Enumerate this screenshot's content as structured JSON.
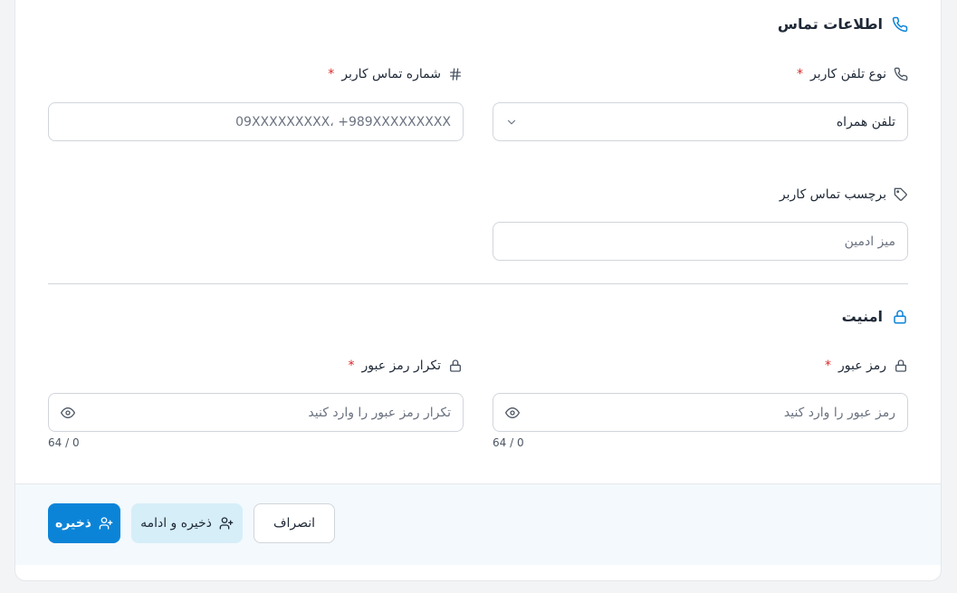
{
  "contact_section": {
    "title": "اطلاعات تماس",
    "phone_type": {
      "label": "نوع تلفن کاربر",
      "required_mark": "*",
      "value": "تلفن همراه"
    },
    "phone_number": {
      "label": "شماره تماس کاربر",
      "required_mark": "*",
      "placeholder": "09XXXXXXXXX، +989XXXXXXXXX"
    },
    "contact_tag": {
      "label": "برچسب تماس کاربر",
      "placeholder": "میز ادمین"
    }
  },
  "security_section": {
    "title": "امنیت",
    "password": {
      "label": "رمز عبور",
      "required_mark": "*",
      "placeholder": "رمز عبور را وارد کنید",
      "counter": "64 / 0"
    },
    "password_confirm": {
      "label": "تکرار رمز عبور",
      "required_mark": "*",
      "placeholder": "تکرار رمز عبور را وارد کنید",
      "counter": "64 / 0"
    }
  },
  "footer": {
    "save_label": "ذخیره",
    "save_continue_label": "ذخیره و ادامه",
    "cancel_label": "انصراف"
  },
  "colors": {
    "accent": "#0b84d8",
    "required": "#dc2626",
    "footer_bg": "#f3f9fc",
    "soft_button": "#d6eef8"
  },
  "icons": {
    "contact_title": "phone-icon",
    "phone_type": "phone-icon",
    "phone_number": "hash-icon",
    "contact_tag": "tag-icon",
    "security_title": "lock-icon",
    "password": "lock-icon",
    "password_confirm": "lock-icon",
    "visibility": "eye-icon",
    "dropdown": "chevron-down-icon",
    "save": "user-plus-icon"
  }
}
